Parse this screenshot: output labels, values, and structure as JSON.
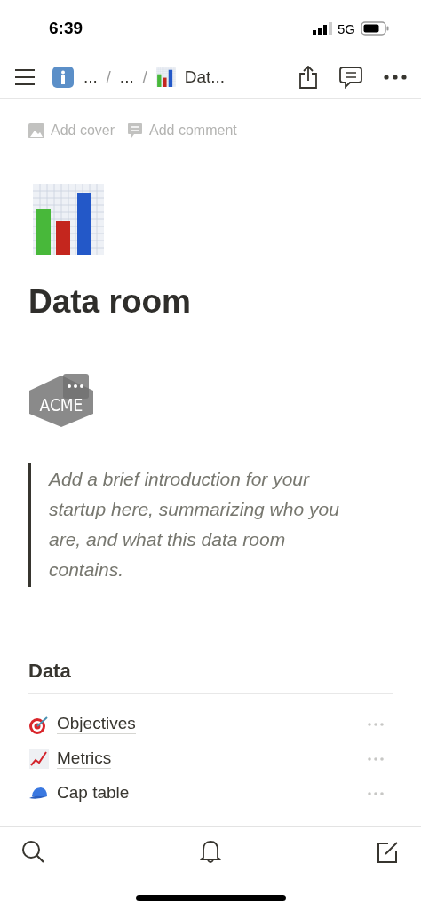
{
  "status_bar": {
    "time": "6:39",
    "network": "5G"
  },
  "nav": {
    "breadcrumbs": [
      "...",
      "...",
      "Dat..."
    ],
    "separator": "/"
  },
  "page_actions": [
    "Add cover",
    "Add comment"
  ],
  "title": "Data room",
  "logo": {
    "text": "ACME"
  },
  "quote": "Add a brief introduction for your startup here, summarizing who you are, and what this data room contains.",
  "section": {
    "heading": "Data",
    "items": [
      {
        "label": "Objectives",
        "kind": "target"
      },
      {
        "label": "Metrics",
        "kind": "chart"
      },
      {
        "label": "Cap table",
        "kind": "cap"
      }
    ]
  }
}
